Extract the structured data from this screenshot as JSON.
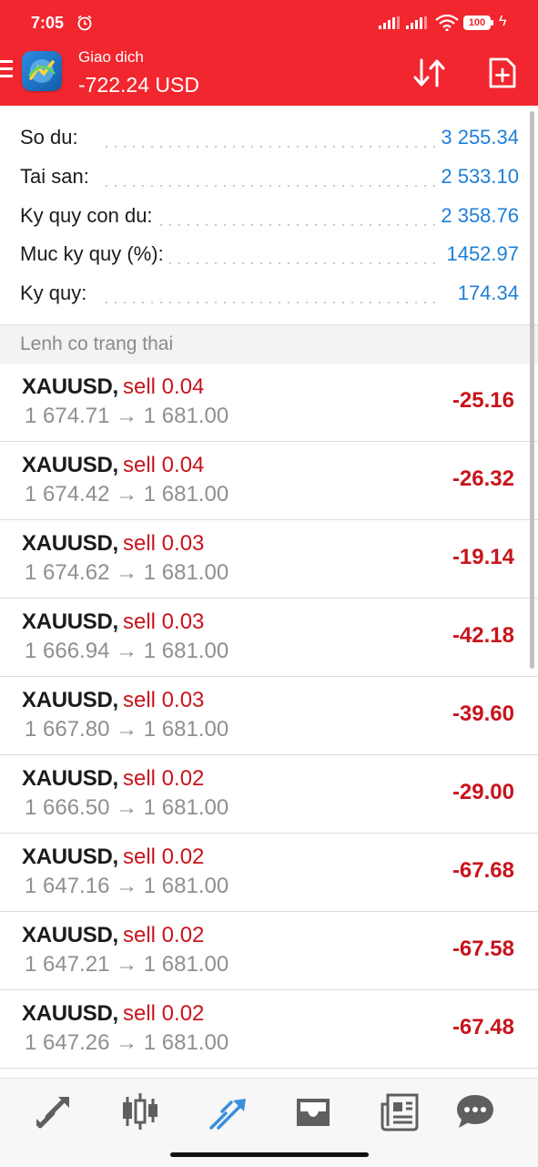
{
  "status_bar": {
    "time": "7:05",
    "battery": "100"
  },
  "header": {
    "title": "Giao dich",
    "balance": "-722.24 USD",
    "icons": [
      "menu-icon",
      "app-logo-icon",
      "sort-icon",
      "new-order-icon"
    ]
  },
  "summary": [
    {
      "label": "So du:",
      "value": "3 255.34"
    },
    {
      "label": "Tai san:",
      "value": "2 533.10"
    },
    {
      "label": "Ky quy con du:",
      "value": "2 358.76"
    },
    {
      "label": "Muc ky quy (%):",
      "value": "1452.97"
    },
    {
      "label": "Ky quy:",
      "value": "174.34"
    }
  ],
  "section_title": "Lenh co trang thai",
  "orders": [
    {
      "symbol": "XAUUSD,",
      "side": "sell 0.04",
      "prices": "1 674.71 → 1 681.00",
      "profit": "-25.16"
    },
    {
      "symbol": "XAUUSD,",
      "side": "sell 0.04",
      "prices": "1 674.42 → 1 681.00",
      "profit": "-26.32"
    },
    {
      "symbol": "XAUUSD,",
      "side": "sell 0.03",
      "prices": "1 674.62 → 1 681.00",
      "profit": "-19.14"
    },
    {
      "symbol": "XAUUSD,",
      "side": "sell 0.03",
      "prices": "1 666.94 → 1 681.00",
      "profit": "-42.18"
    },
    {
      "symbol": "XAUUSD,",
      "side": "sell 0.03",
      "prices": "1 667.80 → 1 681.00",
      "profit": "-39.60"
    },
    {
      "symbol": "XAUUSD,",
      "side": "sell 0.02",
      "prices": "1 666.50 → 1 681.00",
      "profit": "-29.00"
    },
    {
      "symbol": "XAUUSD,",
      "side": "sell 0.02",
      "prices": "1 647.16 → 1 681.00",
      "profit": "-67.68"
    },
    {
      "symbol": "XAUUSD,",
      "side": "sell 0.02",
      "prices": "1 647.21 → 1 681.00",
      "profit": "-67.58"
    },
    {
      "symbol": "XAUUSD,",
      "side": "sell 0.02",
      "prices": "1 647.26 → 1 681.00",
      "profit": "-67.48"
    }
  ],
  "tabs": [
    {
      "name": "quotes-tab",
      "icon": "quotes-arrows-icon",
      "active": false
    },
    {
      "name": "chart-tab",
      "icon": "candlestick-icon",
      "active": false
    },
    {
      "name": "trade-tab",
      "icon": "trade-icon",
      "active": true
    },
    {
      "name": "history-tab",
      "icon": "inbox-icon",
      "active": false
    },
    {
      "name": "news-tab",
      "icon": "news-icon",
      "active": false
    },
    {
      "name": "chat-tab",
      "icon": "chat-icon",
      "active": false
    }
  ],
  "colors": {
    "header_red": "#f2262e",
    "value_blue": "#1e7fd8",
    "loss_red": "#c8141c",
    "active_tab_blue": "#3a8fdc",
    "tab_gray": "#5f5f5f"
  }
}
